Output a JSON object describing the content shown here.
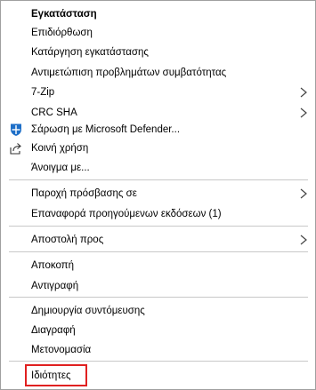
{
  "menu": {
    "items": [
      {
        "label": "Εγκατάσταση"
      },
      {
        "label": "Επιδιόρθωση"
      },
      {
        "label": "Κατάργηση εγκατάστασης"
      },
      {
        "label": "Αντιμετώπιση προβλημάτων συμβατότητας"
      },
      {
        "label": "7-Zip"
      },
      {
        "label": "CRC SHA"
      },
      {
        "label": "Σάρωση με Microsoft Defender..."
      },
      {
        "label": "Κοινή χρήση"
      },
      {
        "label": "Άνοιγμα με..."
      },
      {
        "label": "Παροχή πρόσβασης σε"
      },
      {
        "label": "Επαναφορά προηγούμενων εκδόσεων (1)"
      },
      {
        "label": "Αποστολή προς"
      },
      {
        "label": "Αποκοπή"
      },
      {
        "label": "Αντιγραφή"
      },
      {
        "label": "Δημιουργία συντόμευσης"
      },
      {
        "label": "Διαγραφή"
      },
      {
        "label": "Μετονομασία"
      },
      {
        "label": "Ιδιότητες"
      }
    ]
  },
  "colors": {
    "defender_blue": "#1e6fc8",
    "highlight_red": "#e02020"
  },
  "icons": {
    "defender": "microsoft-defender-shield-icon",
    "share": "share-icon",
    "submenu": "chevron-right-icon"
  }
}
